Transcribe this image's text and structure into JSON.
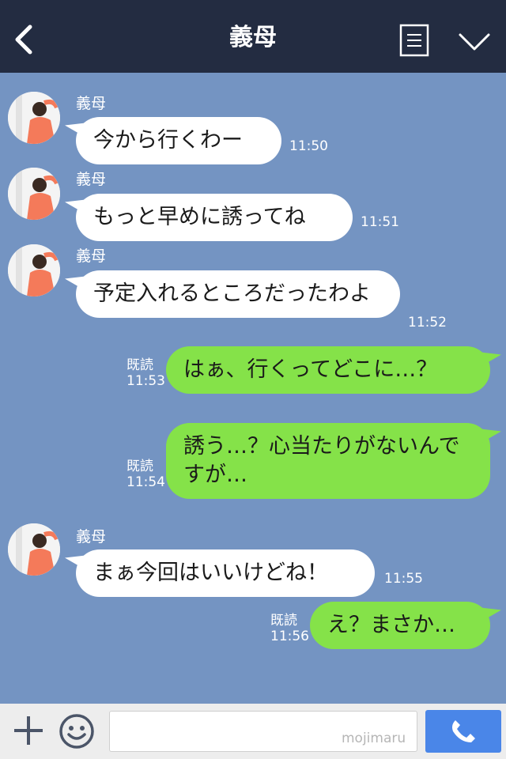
{
  "header": {
    "title": "義母",
    "back_icon": "chevron-left-icon",
    "menu_icon": "list-icon",
    "collapse_icon": "chevron-down-icon"
  },
  "messages": [
    {
      "side": "in",
      "sender": "義母",
      "text": "今から行くわー",
      "time": "11:50"
    },
    {
      "side": "in",
      "sender": "義母",
      "text": "もっと早めに誘ってね",
      "time": "11:51"
    },
    {
      "side": "in",
      "sender": "義母",
      "text": "予定入れるところだったわよ",
      "time": "11:52"
    },
    {
      "side": "out",
      "read": "既読",
      "text": "はぁ、行くってどこに…？",
      "time": "11:53"
    },
    {
      "side": "out",
      "read": "既読",
      "text": "誘う…？心当たりがないんですが…",
      "time": "11:54"
    },
    {
      "side": "in",
      "sender": "義母",
      "text": "まぁ今回はいいけどね！",
      "time": "11:55"
    },
    {
      "side": "out",
      "read": "既読",
      "text": "え？まさか…",
      "time": "11:56"
    }
  ],
  "footer": {
    "input_value": "",
    "watermark": "mojimaru",
    "plus_icon": "plus-icon",
    "emoji_icon": "smiley-icon",
    "call_icon": "phone-icon"
  },
  "colors": {
    "header_bg": "#232c41",
    "chat_bg": "#7494c2",
    "incoming_bubble": "#ffffff",
    "outgoing_bubble": "#85e249",
    "call_button": "#4a86e8"
  }
}
